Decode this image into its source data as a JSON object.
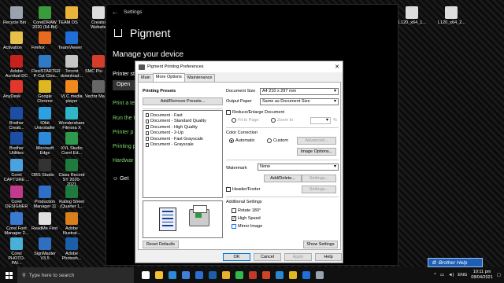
{
  "desktop": {
    "icons": [
      {
        "label": "Recycle Bin",
        "color": "#9aa3ad"
      },
      {
        "label": "CorelDRAW 2020 (64-Bit)",
        "color": "#3a9b3a"
      },
      {
        "label": "TEAM OS",
        "color": "#e8b43a"
      },
      {
        "label": "Creatio Website",
        "color": "#ddd"
      },
      {
        "label": "Activation",
        "color": "#e6c04a"
      },
      {
        "label": "Firefox",
        "color": "#e66a1f"
      },
      {
        "label": "TeamViewer",
        "color": "#1f6fd6"
      },
      {
        "label": "Adobe Acrobat DC",
        "color": "#c8201c"
      },
      {
        "label": "FlexiSTARTER P-Cut Clou...",
        "color": "#2f7ac6"
      },
      {
        "label": "Torrent download...",
        "color": "#c5c5c5"
      },
      {
        "label": "SMC Plu",
        "color": "#d43d2a"
      },
      {
        "label": "AnyDesk",
        "color": "#e2372b"
      },
      {
        "label": "Google Chrome",
        "color": "#dfb722"
      },
      {
        "label": "VLC media player",
        "color": "#f08a1c"
      },
      {
        "label": "Vector Ma",
        "color": "#666"
      },
      {
        "label": "Brother Creati...",
        "color": "#1c4fa3"
      },
      {
        "label": "IObit Uninstaller",
        "color": "#2da0e2"
      },
      {
        "label": "Wondershare Filmora X",
        "color": "#2fb6c9"
      },
      {
        "label": "Brother Utilities",
        "color": "#1c4fa3"
      },
      {
        "label": "Microsoft Edge",
        "color": "#2c8ad8"
      },
      {
        "label": "XVL Studio Corel Ed...",
        "color": "#2f9a4c"
      },
      {
        "label": "Corel CAPTURE ...",
        "color": "#4aa3e0"
      },
      {
        "label": "OBS Studio",
        "color": "#333"
      },
      {
        "label": "Class Record SY 2020-2021",
        "color": "#1e7a3d"
      },
      {
        "label": "Corel DESIGNER ...",
        "color": "#c23b8a"
      },
      {
        "label": "Production Manager 11",
        "color": "#2f6fc6"
      },
      {
        "label": "Rating Sheet (Quarter 1...",
        "color": "#1e7a3d"
      },
      {
        "label": "Corel Font Manager 2...",
        "color": "#3a7ad0"
      },
      {
        "label": "ReadMe First",
        "color": "#e0e0e0"
      },
      {
        "label": "Adobe Illustrat...",
        "color": "#d9801c"
      },
      {
        "label": "Corel PHOTO-PAI...",
        "color": "#4ab0d8"
      },
      {
        "label": "SignMaster V3.5",
        "color": "#2e6fc0"
      },
      {
        "label": "Adobe Photosh...",
        "color": "#1b5fa8"
      },
      {
        "label": "L120_x64_1...",
        "color": "#ddd"
      },
      {
        "label": "L120_x64_2...",
        "color": "#ddd"
      }
    ]
  },
  "settings": {
    "title": "Settings",
    "heading": "Pigment",
    "subheading": "Manage your device",
    "printer_status": "Printer st",
    "open_label": "Open",
    "items": [
      "Print a te",
      "Run the t",
      "Printer p",
      "Printing p",
      "Hardwar"
    ],
    "get_label": "Get"
  },
  "dialog": {
    "title": "Pigment Printing Preferences",
    "tabs": [
      "Main",
      "More Options",
      "Maintenance"
    ],
    "printing_presets_label": "Printing Presets",
    "add_remove_presets": "Add/Remove Presets...",
    "presets": [
      "Document - Fast",
      "Document - Standard Quality",
      "Document - High Quality",
      "Document - 2-Up",
      "Document - Fast Grayscale",
      "Document - Grayscale"
    ],
    "reset_defaults": "Reset Defaults",
    "document_size_label": "Document Size",
    "document_size_value": "A4 210 x 297 mm",
    "output_paper_label": "Output Paper",
    "output_paper_value": "Same as Document Size",
    "reduce_enlarge": "Reduce/Enlarge Document",
    "fit_to_page": "Fit to Page",
    "zoom_to": "Zoom to",
    "zoom_unit": "%",
    "color_correction_label": "Color Correction",
    "automatic": "Automatic",
    "custom": "Custom",
    "advanced": "Advanced...",
    "image_options": "Image Options...",
    "watermark_label": "Watermark",
    "watermark_value": "None",
    "add_delete": "Add/Delete...",
    "settings_btn": "Settings...",
    "header_footer": "Header/Footer",
    "settings_btn2": "Settings...",
    "additional_settings_label": "Additional Settings",
    "rotate_180": "Rotate 180°",
    "high_speed": "High Speed",
    "mirror_image": "Mirror Image",
    "show_settings": "Show Settings",
    "ok": "OK",
    "cancel": "Cancel",
    "apply": "Apply",
    "help": "Help"
  },
  "brother_help": "Brother Help",
  "taskbar": {
    "search_placeholder": "Type here to search",
    "apps": [
      {
        "name": "task-view",
        "color": "#ffffff"
      },
      {
        "name": "file-explorer",
        "color": "#f2c233"
      },
      {
        "name": "edge",
        "color": "#2c8ad8"
      },
      {
        "name": "store",
        "color": "#3f7fd9"
      },
      {
        "name": "mail",
        "color": "#2a6fcf"
      },
      {
        "name": "photoshop",
        "color": "#1b5fa8"
      },
      {
        "name": "file-explorer-2",
        "color": "#e6b12d"
      },
      {
        "name": "whatsapp",
        "color": "#2fbb4a"
      },
      {
        "name": "illustrator",
        "color": "#c0392b"
      },
      {
        "name": "powerpoint",
        "color": "#d04423"
      },
      {
        "name": "vscode",
        "color": "#2a88d0"
      },
      {
        "name": "chrome",
        "color": "#dfb722"
      },
      {
        "name": "teamviewer",
        "color": "#1f6fd6"
      },
      {
        "name": "printer",
        "color": "#9aa3ad"
      }
    ],
    "language": "ENG",
    "time": "10:11 pm",
    "date": "08/04/2021"
  }
}
